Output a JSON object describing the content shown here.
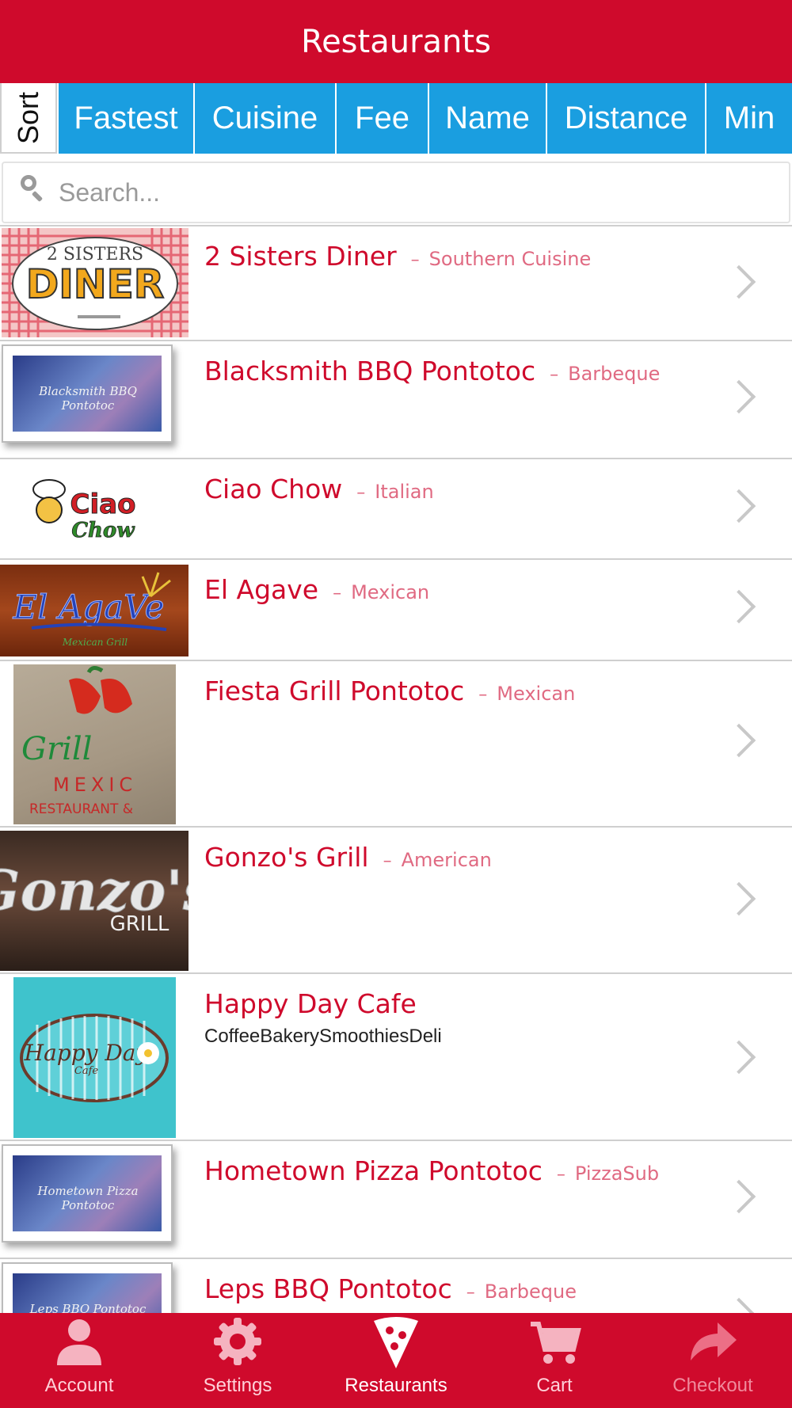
{
  "header": {
    "title": "Restaurants"
  },
  "sort": {
    "label": "Sort",
    "options": [
      "Fastest",
      "Cuisine",
      "Fee",
      "Name",
      "Distance",
      "Min"
    ]
  },
  "search": {
    "placeholder": "Search..."
  },
  "restaurants": [
    {
      "name": "2 Sisters Diner",
      "separator": "–",
      "cuisine": "Southern Cuisine",
      "logo_text": "2 SISTERS DINER"
    },
    {
      "name": "Blacksmith BBQ Pontotoc",
      "separator": "–",
      "cuisine": "Barbeque",
      "logo_text": "Blacksmith BBQ Pontotoc"
    },
    {
      "name": "Ciao Chow",
      "separator": "–",
      "cuisine": "Italian",
      "logo_text": "Ciao Chow"
    },
    {
      "name": "El Agave",
      "separator": "–",
      "cuisine": "Mexican",
      "logo_text": "El Agave"
    },
    {
      "name": "Fiesta Grill Pontotoc",
      "separator": "–",
      "cuisine": "Mexican",
      "logo_text": "Grill MEXIC RESTAURANT"
    },
    {
      "name": "Gonzo's Grill",
      "separator": "–",
      "cuisine": "American",
      "logo_text": "Gonzo's GRILL"
    },
    {
      "name": "Happy Day Cafe",
      "subline": "CoffeeBakerySmoothiesDeli",
      "logo_text": "Happy Day Cafe"
    },
    {
      "name": "Hometown Pizza Pontotoc",
      "separator": "–",
      "cuisine": "PizzaSub",
      "logo_text": "Hometown Pizza Pontotoc"
    },
    {
      "name": "Leps BBQ Pontotoc",
      "separator": "–",
      "cuisine": "Barbeque",
      "logo_text": "Leps BBQ Pontotoc"
    }
  ],
  "tabs": [
    {
      "label": "Account",
      "icon": "user-icon",
      "state": "normal"
    },
    {
      "label": "Settings",
      "icon": "gear-icon",
      "state": "normal"
    },
    {
      "label": "Restaurants",
      "icon": "pizza-icon",
      "state": "active"
    },
    {
      "label": "Cart",
      "icon": "cart-icon",
      "state": "normal"
    },
    {
      "label": "Checkout",
      "icon": "share-arrow-icon",
      "state": "disabled"
    }
  ],
  "colors": {
    "brand_red": "#cf0a2c",
    "sort_blue": "#1a9ee0",
    "cuisine_pink": "#e06a82"
  }
}
